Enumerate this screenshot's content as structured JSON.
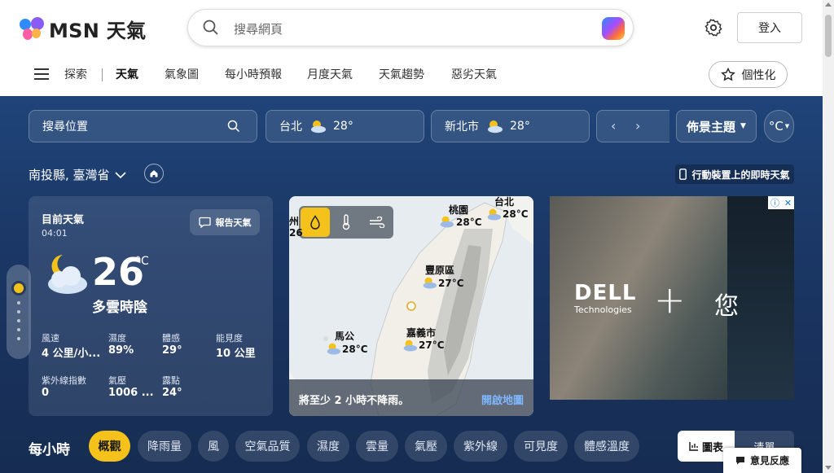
{
  "header": {
    "logo_text": "MSN 天氣",
    "search_placeholder": "搜尋網頁",
    "login_label": "登入"
  },
  "nav": {
    "items": [
      "探索",
      "天氣",
      "氣象圖",
      "每小時預報",
      "月度天氣",
      "天氣趨勢",
      "惡劣天氣"
    ],
    "active": "天氣",
    "personalize_label": "個性化"
  },
  "toolbar": {
    "location_search_placeholder": "搜尋位置",
    "cities": [
      {
        "name": "台北",
        "temp": "28°"
      },
      {
        "name": "新北市",
        "temp": "28°"
      }
    ],
    "theme_label": "佈景主題",
    "unit_label": "°C",
    "region": "南投縣, 臺灣省",
    "mobile_label": "行動裝置上的即時天氣"
  },
  "current": {
    "title": "目前天氣",
    "time": "04:01",
    "report_label": "報告天氣",
    "temperature": "26",
    "unit": "°C",
    "condition": "多雲時陰",
    "stats": [
      {
        "label": "風速",
        "value": "4 公里/小..."
      },
      {
        "label": "濕度",
        "value": "89%"
      },
      {
        "label": "體感",
        "value": "29°"
      },
      {
        "label": "能見度",
        "value": "10 公里"
      },
      {
        "label": "紫外線指數",
        "value": "0"
      },
      {
        "label": "氣壓",
        "value": "1006 ..."
      },
      {
        "label": "露點",
        "value": "24°"
      }
    ]
  },
  "map": {
    "labels": [
      {
        "name": "桃園",
        "temp": "28°C"
      },
      {
        "name": "台北",
        "temp": "28°C"
      },
      {
        "name": "豐原區",
        "temp": "27°C"
      },
      {
        "name": "嘉義市",
        "temp": "27°C"
      },
      {
        "name": "馬公",
        "temp": "28°C"
      },
      {
        "name": "州",
        "temp": "26"
      }
    ],
    "message": "將至少 2 小時不降雨。",
    "open_label": "開啟地圖"
  },
  "ad": {
    "brand": "DELL",
    "brand_sub": "Technologies",
    "plus": "+",
    "you": "您"
  },
  "hourly": {
    "title": "每小時",
    "chips": [
      "概觀",
      "降雨量",
      "風",
      "空氣品質",
      "濕度",
      "雲量",
      "氣壓",
      "紫外線",
      "可見度",
      "體感溫度"
    ],
    "selected": "概觀",
    "view_chart": "圖表",
    "view_list": "清單"
  },
  "feedback_label": "意見反應",
  "colors": {
    "accent_yellow": "#f4c21a",
    "bg_dark_blue": "#1b3765",
    "link_blue": "#7fb7ff"
  }
}
